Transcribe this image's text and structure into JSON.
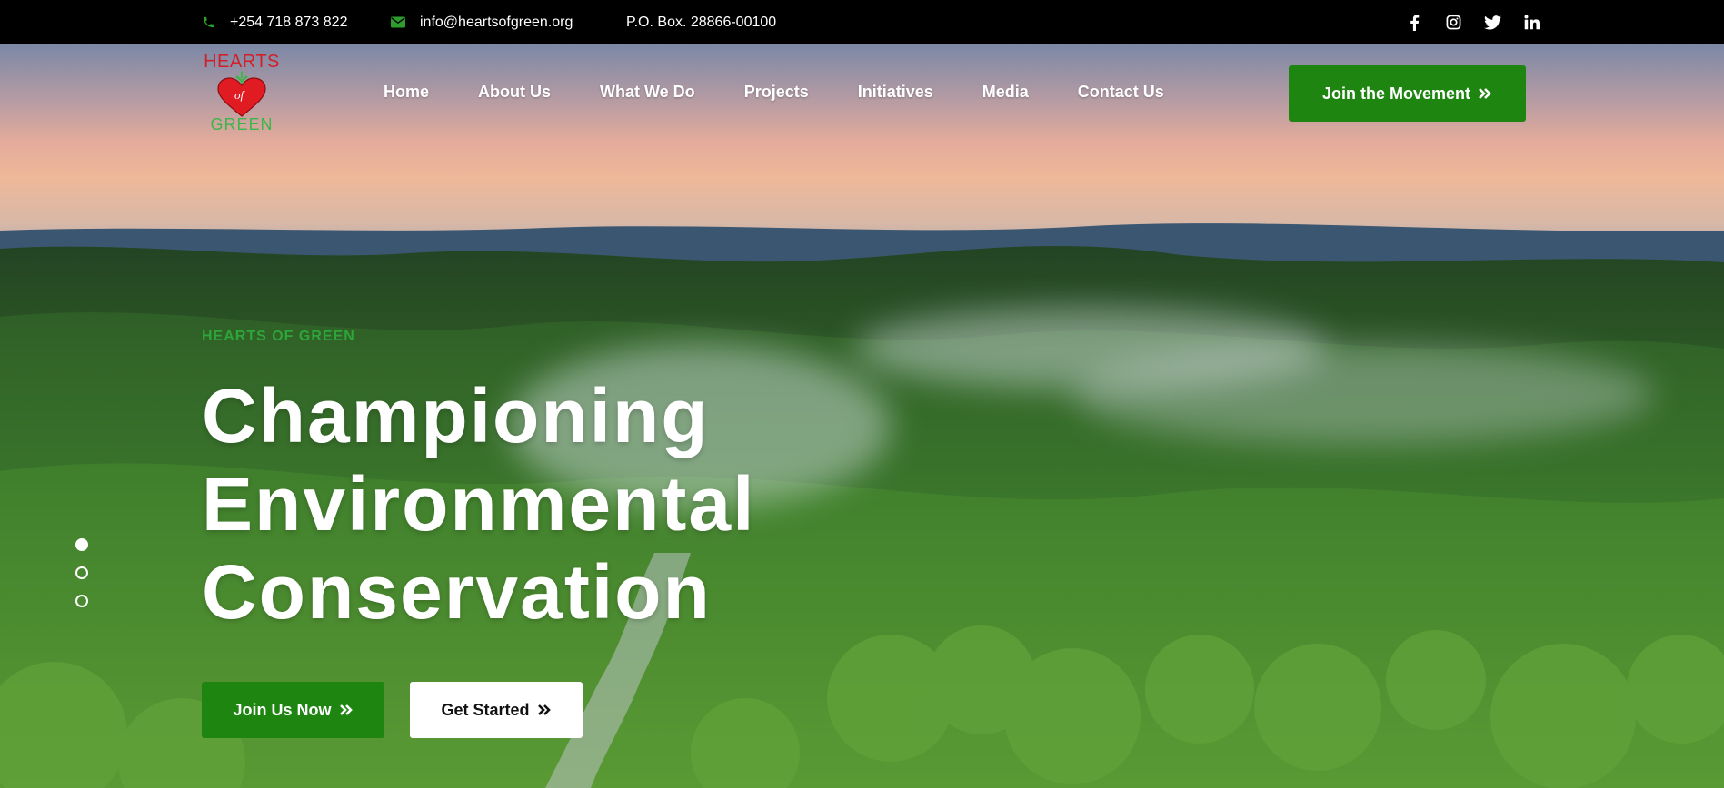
{
  "topbar": {
    "phone": "+254 718 873 822",
    "email": "info@heartsofgreen.org",
    "pobox": "P.O. Box. 28866-00100",
    "social": [
      "facebook-icon",
      "instagram-icon",
      "twitter-icon",
      "linkedin-icon"
    ]
  },
  "logo": {
    "line1": "HEARTS",
    "middle": "of",
    "line2": "GREEN"
  },
  "nav": {
    "items": [
      "Home",
      "About Us",
      "What We Do",
      "Projects",
      "Initiatives",
      "Media",
      "Contact Us"
    ]
  },
  "cta": {
    "join_movement": "Join the Movement"
  },
  "hero": {
    "eyebrow": "HEARTS OF GREEN",
    "line1": "Championing",
    "line2": "Environmental",
    "line3": "Conservation",
    "join_now": "Join Us Now",
    "get_started": "Get Started"
  },
  "slider": {
    "count": 3,
    "active": 1
  },
  "colors": {
    "brand_green": "#1e8510",
    "eyebrow_green": "#2da53a",
    "logo_red": "#d0202a",
    "topbar_bg": "#000000"
  }
}
